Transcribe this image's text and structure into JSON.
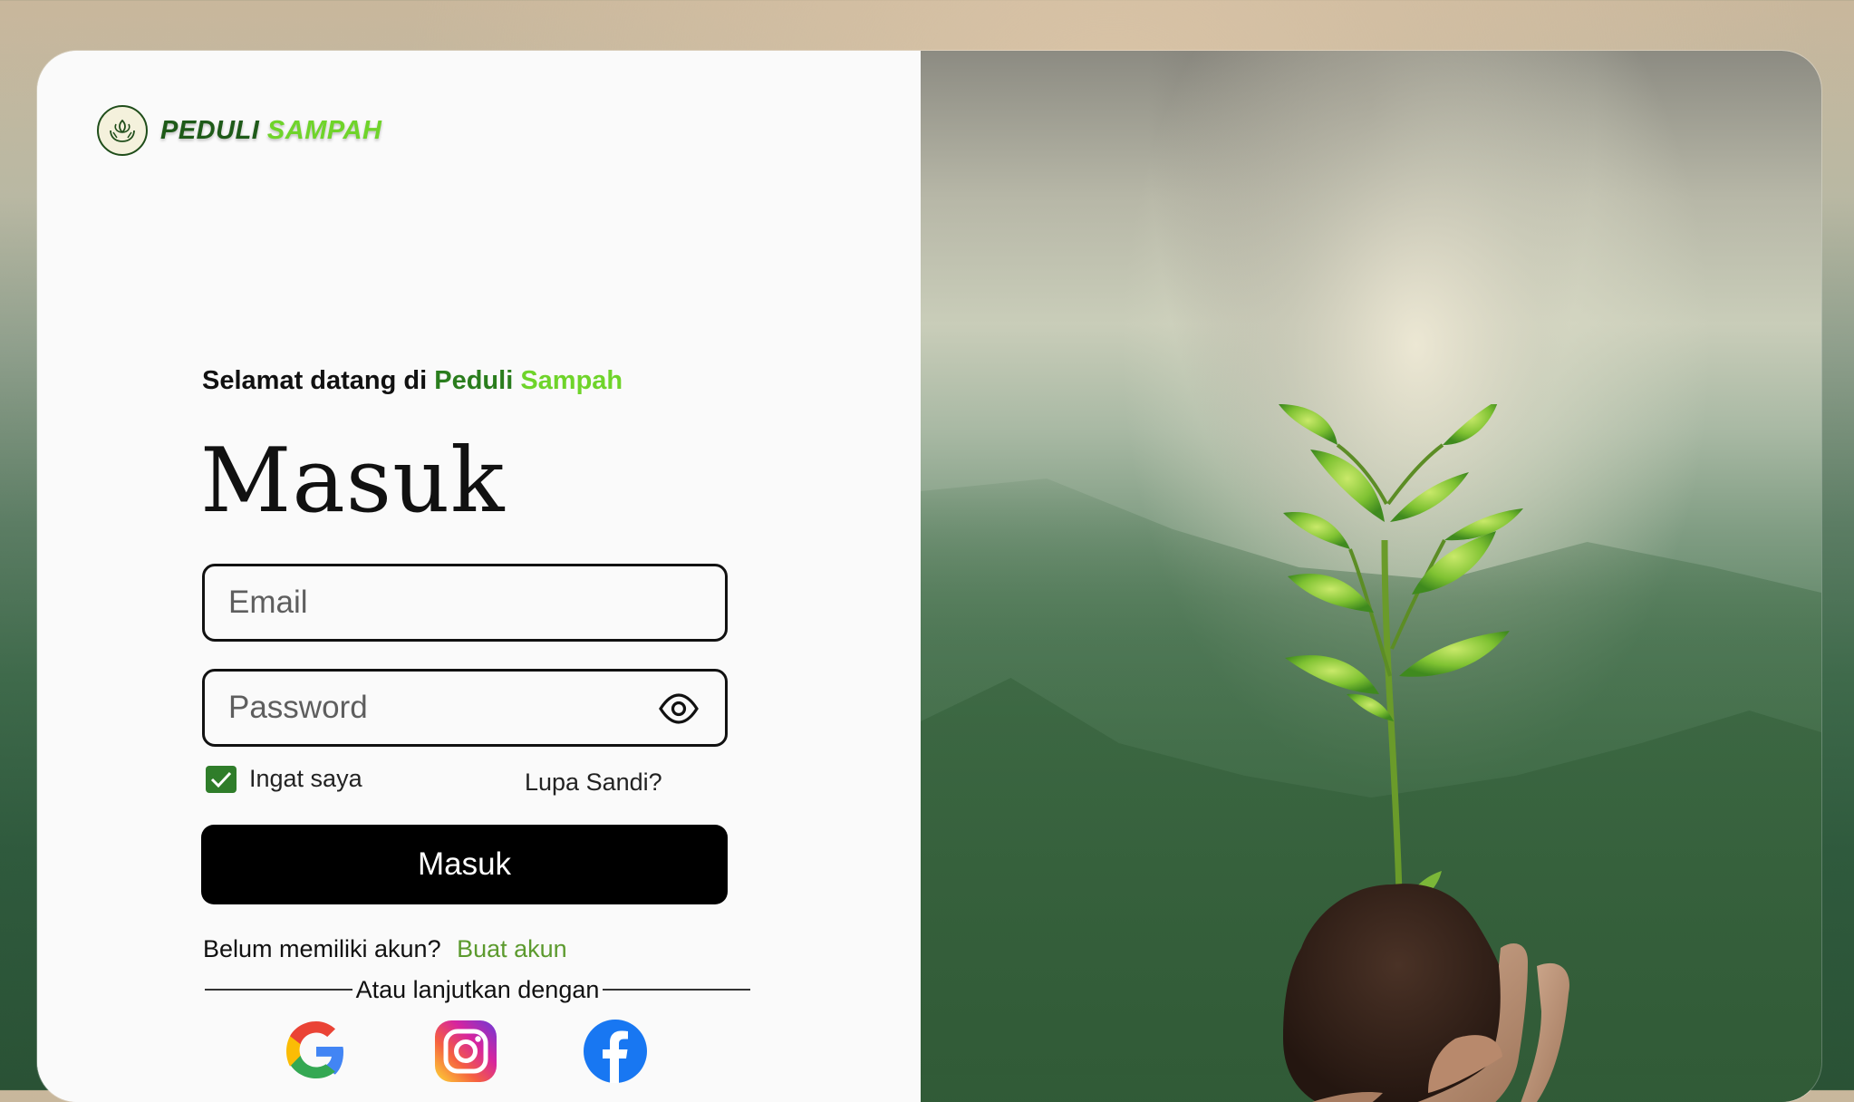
{
  "brand": {
    "name_dark": "PEDULI",
    "name_light": "SAMPAH"
  },
  "welcome": {
    "prefix": "Selamat datang di",
    "brand_a": "Peduli",
    "brand_b": "Sampah"
  },
  "title": "Masuk",
  "email": {
    "placeholder": "Email",
    "value": ""
  },
  "password": {
    "placeholder": "Password",
    "value": ""
  },
  "remember": {
    "label": "Ingat saya",
    "checked": true
  },
  "forgot_label": "Lupa Sandi?",
  "submit_label": "Masuk",
  "signup": {
    "prompt": "Belum memiliki akun?",
    "link": "Buat akun"
  },
  "divider_text": "Atau lanjutkan dengan",
  "social": [
    {
      "name": "google-icon"
    },
    {
      "name": "instagram-icon"
    },
    {
      "name": "facebook-icon"
    }
  ],
  "colors": {
    "brand_dark": "#1e5a18",
    "brand_light": "#6fd42a",
    "link": "#5c9a2e",
    "checkbox": "#2f7d2a",
    "button": "#000000"
  }
}
